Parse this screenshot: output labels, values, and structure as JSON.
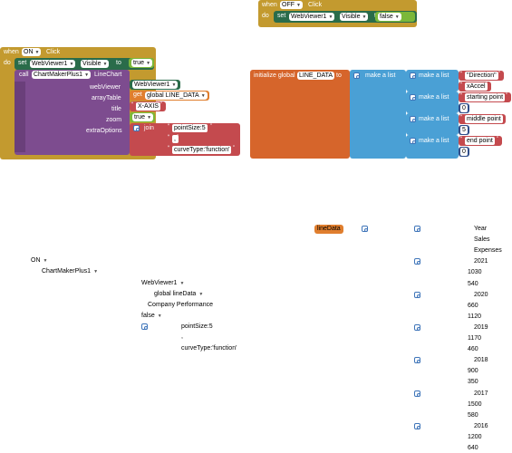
{
  "off_block": {
    "when": "when",
    "button": "OFF",
    "event": "Click",
    "do": "do",
    "set": "set",
    "component": "WebViewer1",
    "property": "Visible",
    "to": "to",
    "value": "false"
  },
  "on_block": {
    "when": "when",
    "button": "ON",
    "event": "Click",
    "do": "do",
    "set": "set",
    "component": "WebViewer1",
    "property": "Visible",
    "to": "to",
    "value": "true",
    "call": "call",
    "chart_component": "ChartMakerPlus1",
    "method": "LineChart",
    "webviewer_label": "webViewer",
    "webviewer_value": "WebViewer1",
    "arraytable_label": "arrayTable",
    "get": "get",
    "arraytable_value": "global LINE_DATA",
    "title_label": "title",
    "title_value": "X-AXIS",
    "zoom_label": "zoom",
    "zoom_value": "true",
    "extraoptions_label": "extraOptions",
    "join": "join",
    "join_1": "pointSize:5",
    "join_2": ",",
    "join_3": "curveType:'function'"
  },
  "global_block": {
    "label": "initialize global",
    "name": "LINE_DATA",
    "to": "to",
    "make_a_list": "make a list",
    "rows": [
      {
        "text": "\"Direction\"",
        "value": "xAccel"
      },
      {
        "text": "starting point",
        "value": "0"
      },
      {
        "text": "middle point",
        "value": "5"
      },
      {
        "text": "end point",
        "value": "0"
      }
    ]
  },
  "collapsed": {
    "on_label": "ON",
    "chartmaker": "ChartMakerPlus1",
    "webviewer": "WebViewer1",
    "global_linedata": "global lineData",
    "company": "Company Performance",
    "false_label": "false",
    "pointsize": "pointSize:5",
    "comma": ",",
    "curvetype": "curveType:'function'",
    "linedata_tag": "lineData",
    "col_values": [
      "Year",
      "Sales",
      "Expenses",
      "2021",
      "1030",
      "540",
      "2020",
      "660",
      "1120",
      "2019",
      "1170",
      "460",
      "2018",
      "900",
      "350",
      "2017",
      "1500",
      "580",
      "2016",
      "1200",
      "640"
    ]
  }
}
